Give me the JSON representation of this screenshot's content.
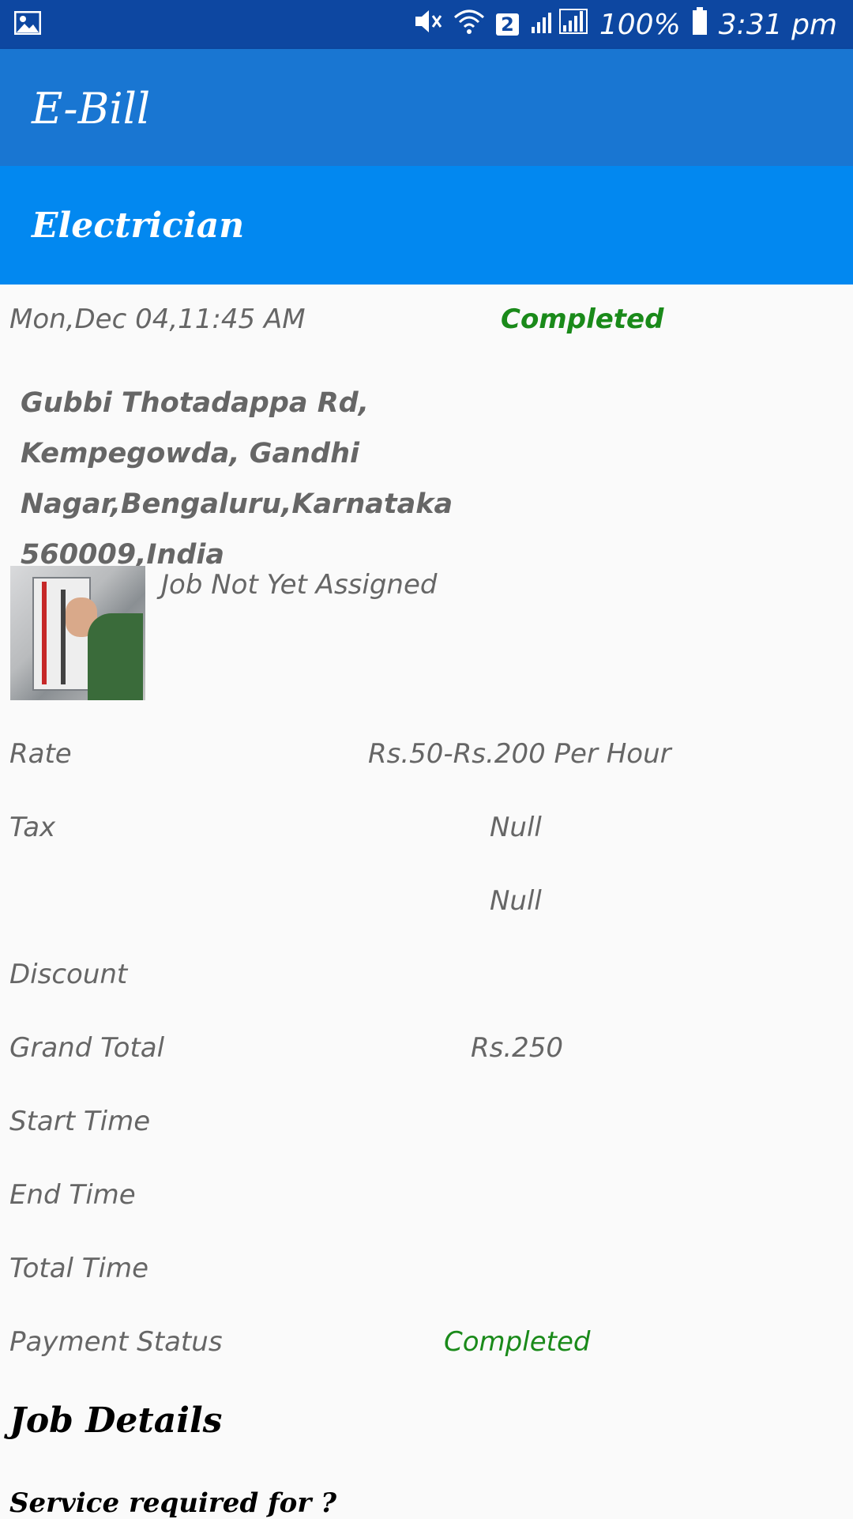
{
  "status_bar": {
    "battery": "100%",
    "time": "3:31 pm",
    "sim_badge": "2",
    "icons": [
      "image-icon",
      "mute-icon",
      "wifi-icon",
      "signal-icon",
      "battery-icon"
    ]
  },
  "app": {
    "title": "E-Bill"
  },
  "section": {
    "title": "Electrician"
  },
  "booking": {
    "datetime": "Mon,Dec 04,11:45 AM",
    "status": "Completed",
    "address": "Gubbi Thotadappa Rd, Kempegowda, Gandhi Nagar,Bengaluru,Karnataka 560009,India",
    "assignment": "Job Not Yet Assigned"
  },
  "bill": {
    "rows": [
      {
        "label": "Rate",
        "value": "Rs.50-Rs.200 Per Hour"
      },
      {
        "label": "Tax",
        "value": "Null"
      },
      {
        "label": "",
        "value": "Null"
      },
      {
        "label": "Discount",
        "value": ""
      },
      {
        "label": "Grand Total",
        "value": "Rs.250"
      },
      {
        "label": "Start Time",
        "value": ""
      },
      {
        "label": "End Time",
        "value": ""
      },
      {
        "label": "Total Time",
        "value": ""
      },
      {
        "label": "Payment Status",
        "value": "Completed"
      }
    ]
  },
  "job_details": {
    "heading": "Job Details",
    "question": "Service required for ?"
  },
  "colors": {
    "status_bar": "#0d47a1",
    "app_bar": "#1976d2",
    "section_header": "#0288f0",
    "status_green": "#1a8a1a"
  }
}
